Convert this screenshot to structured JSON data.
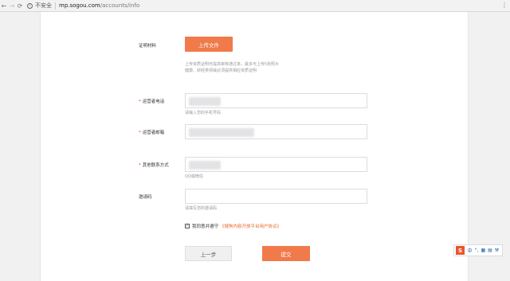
{
  "browser": {
    "back_icon": "arrow-left-icon",
    "forward_icon": "arrow-right-icon",
    "reload_icon": "reload-icon",
    "security_label": "不安全",
    "url_host": "mp.sogou.com",
    "url_path": "/accounts/info"
  },
  "form": {
    "cert_label": "证明材料",
    "upload_button": "上传文件",
    "upload_hint_line1": "上传资质证明可提高审核通过率，最多可上传5张照片",
    "upload_hint_line2": "健康、财经类领域必须提供相应资质证明",
    "phone_label": "运营者电话",
    "phone_hint": "请输入您的手机号码",
    "email_label": "运营者邮箱",
    "other_contact_label": "其他联系方式",
    "other_contact_hint": "QQ或微信",
    "invite_label": "邀请码",
    "invite_hint": "请填写您的邀请码",
    "agree_text": "我同意并遵守",
    "agree_link": "《搜狗内容开放平台用户协议》",
    "prev_button": "上一步",
    "submit_button": "提交",
    "required_mark": "*",
    "check_mark": "✓"
  },
  "ime": {
    "logo": "S",
    "items": [
      "中",
      "°,",
      "▦",
      "▤",
      "⚒"
    ]
  },
  "colors": {
    "accent": "#f07a4a",
    "required": "#e33333"
  }
}
